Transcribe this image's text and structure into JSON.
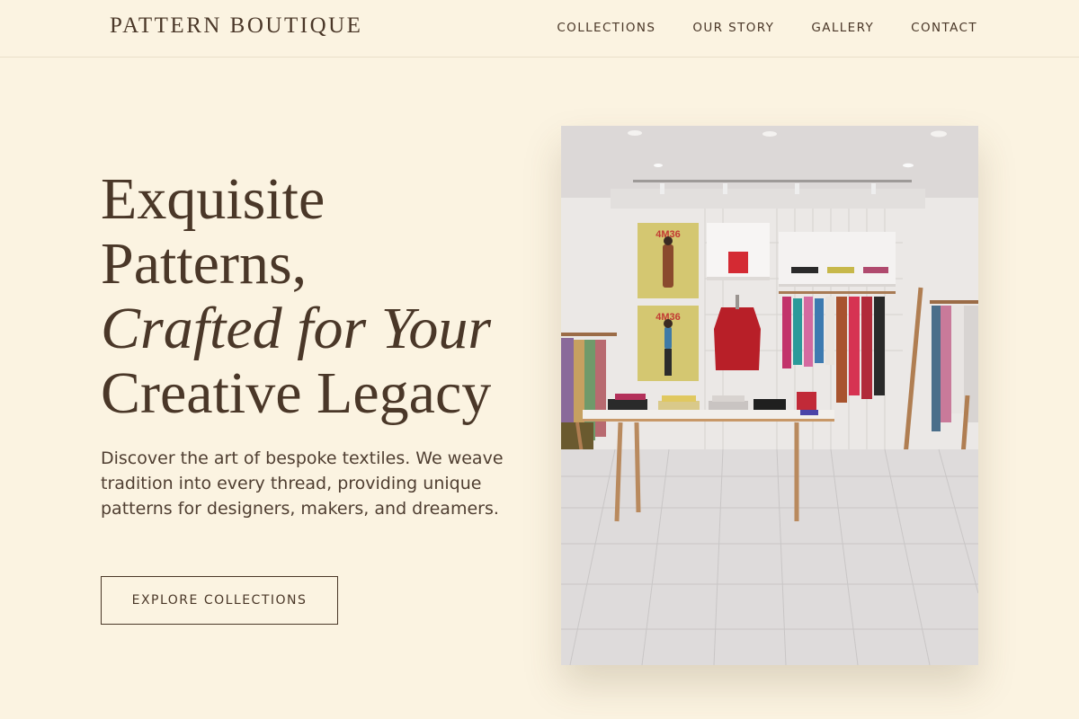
{
  "header": {
    "brand": "PATTERN BOUTIQUE",
    "nav": [
      {
        "label": "COLLECTIONS"
      },
      {
        "label": "OUR STORY"
      },
      {
        "label": "GALLERY"
      },
      {
        "label": "CONTACT"
      }
    ]
  },
  "hero": {
    "title_lines": [
      "Exquisite",
      "Patterns,",
      "Crafted for Your",
      "Creative Legacy"
    ],
    "description": "Discover the art of bespoke textiles. We weave tradition into every thread, providing unique patterns for designers, makers, and dreamers.",
    "cta_label": "EXPLORE COLLECTIONS",
    "image": {
      "poster_text": "4M36"
    }
  },
  "colors": {
    "background": "#fbf3e1",
    "text": "#4a3728",
    "border": "#eadfca"
  }
}
